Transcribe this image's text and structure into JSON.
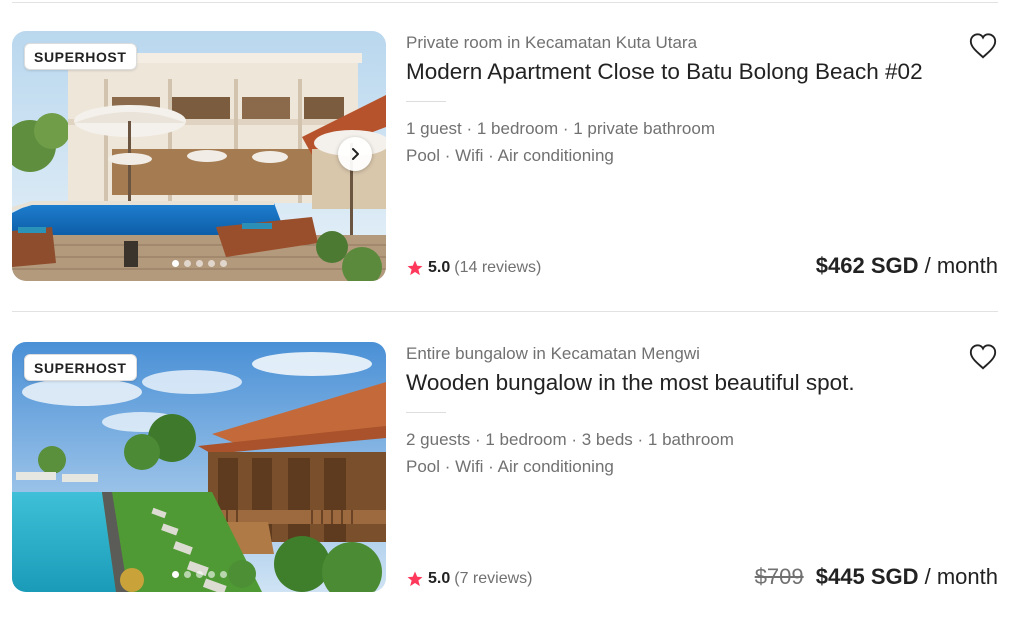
{
  "listings": [
    {
      "badge": "SUPERHOST",
      "subtitle": "Private room in Kecamatan Kuta Utara",
      "title": "Modern Apartment Close to Batu Bolong Beach #02",
      "details_line1": "1 guest · 1 bedroom · 1 private bathroom",
      "details_line2": "Pool · Wifi · Air conditioning",
      "rating": "5.0",
      "reviews": "(14 reviews)",
      "old_price": "",
      "price": "$462 SGD",
      "period": "/ month",
      "has_next_button": true,
      "icons": [
        "heart-icon",
        "star-icon",
        "chevron-right-icon"
      ]
    },
    {
      "badge": "SUPERHOST",
      "subtitle": "Entire bungalow in Kecamatan Mengwi",
      "title": "Wooden bungalow in the most beautiful spot.",
      "details_line1": "2 guests · 1 bedroom · 3 beds · 1 bathroom",
      "details_line2": "Pool · Wifi · Air conditioning",
      "rating": "5.0",
      "reviews": "(7 reviews)",
      "old_price": "$709",
      "price": "$445 SGD",
      "period": "/ month",
      "has_next_button": false,
      "icons": [
        "heart-icon",
        "star-icon"
      ]
    }
  ],
  "colors": {
    "star": "#ff385c",
    "muted_text": "#717171",
    "primary_text": "#222222",
    "divider": "#e2e2e2"
  }
}
